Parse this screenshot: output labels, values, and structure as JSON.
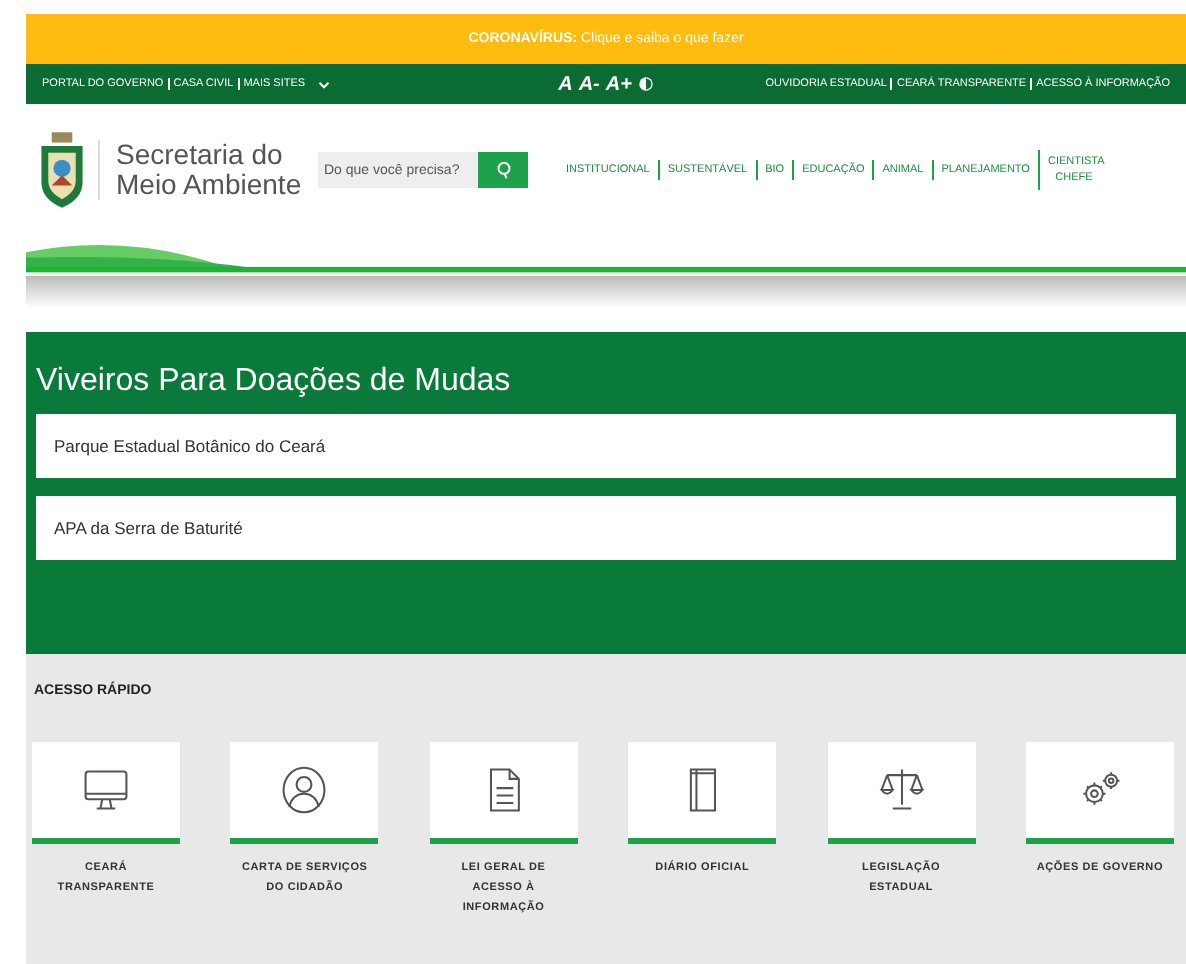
{
  "alert_bar": {
    "title": "CORONAVÍRUS:",
    "text": "Clique e saiba o que fazer"
  },
  "top_bar": {
    "left_links": [
      "PORTAL DO GOVERNO",
      "CASA CIVIL",
      "MAIS SITES"
    ],
    "font_controls": [
      "A",
      "A-",
      "A+"
    ],
    "right_links": [
      "OUVIDORIA ESTADUAL",
      "CEARÁ TRANSPARENTE",
      "ACESSO À INFORMAÇÃO"
    ]
  },
  "header": {
    "site_name": "Secretaria do Meio Ambiente",
    "search": {
      "placeholder": "Do que você precisa?"
    },
    "nav": [
      "INSTITUCIONAL",
      "SUSTENTÁVEL",
      "BIO",
      "EDUCAÇÃO",
      "ANIMAL",
      "PLANEJAMENTO",
      "CIENTISTA CHEFE"
    ]
  },
  "nurseries": {
    "title": "Viveiros Para Doações de Mudas",
    "items": [
      "Parque Estadual Botânico do Ceará",
      "APA da Serra de Baturité"
    ]
  },
  "quick_access": {
    "title": "ACESSO RÁPIDO",
    "items": [
      {
        "kind": "monitor",
        "label": "CEARÁ TRANSPARENTE"
      },
      {
        "kind": "person",
        "label": "CARTA DE SERVIÇOS DO CIDADÃO"
      },
      {
        "kind": "document",
        "label": "LEI GERAL DE ACESSO À INFORMAÇÃO"
      },
      {
        "kind": "book",
        "label": "DIÁRIO OFICIAL"
      },
      {
        "kind": "scales",
        "label": "LEGISLAÇÃO ESTADUAL"
      },
      {
        "kind": "gears",
        "label": "AÇÕES DE GOVERNO"
      }
    ]
  }
}
